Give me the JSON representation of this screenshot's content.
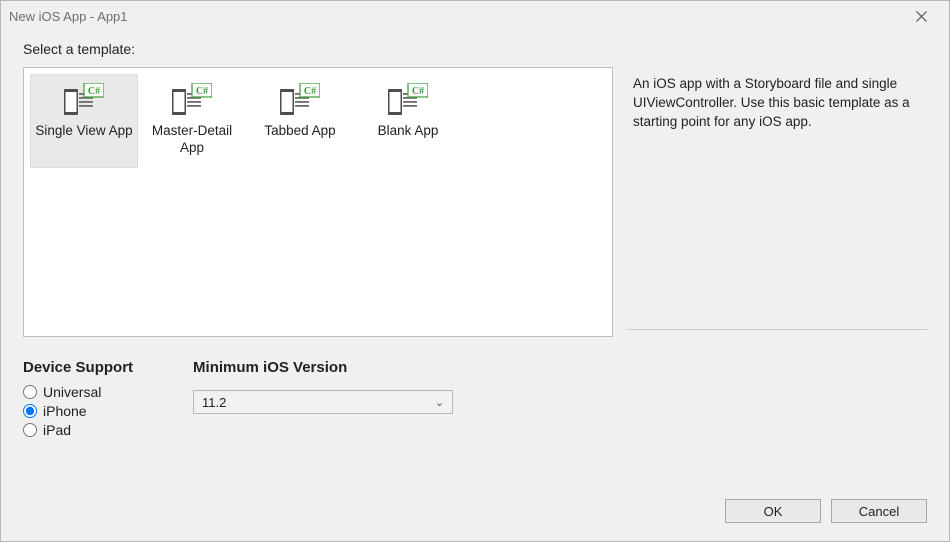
{
  "window": {
    "title": "New iOS App - App1"
  },
  "prompt": "Select a template:",
  "templates": {
    "items": [
      {
        "label": "Single View App",
        "selected": true
      },
      {
        "label": "Master-Detail App",
        "selected": false
      },
      {
        "label": "Tabbed App",
        "selected": false
      },
      {
        "label": "Blank App",
        "selected": false
      }
    ]
  },
  "description": "An iOS app with a Storyboard file and single UIViewController. Use this basic template as a starting point for any iOS app.",
  "device_support": {
    "title": "Device Support",
    "options": [
      {
        "label": "Universal",
        "checked": false
      },
      {
        "label": "iPhone",
        "checked": true
      },
      {
        "label": "iPad",
        "checked": false
      }
    ]
  },
  "min_ios": {
    "title": "Minimum iOS Version",
    "selected": "11.2"
  },
  "buttons": {
    "ok": "OK",
    "cancel": "Cancel"
  }
}
